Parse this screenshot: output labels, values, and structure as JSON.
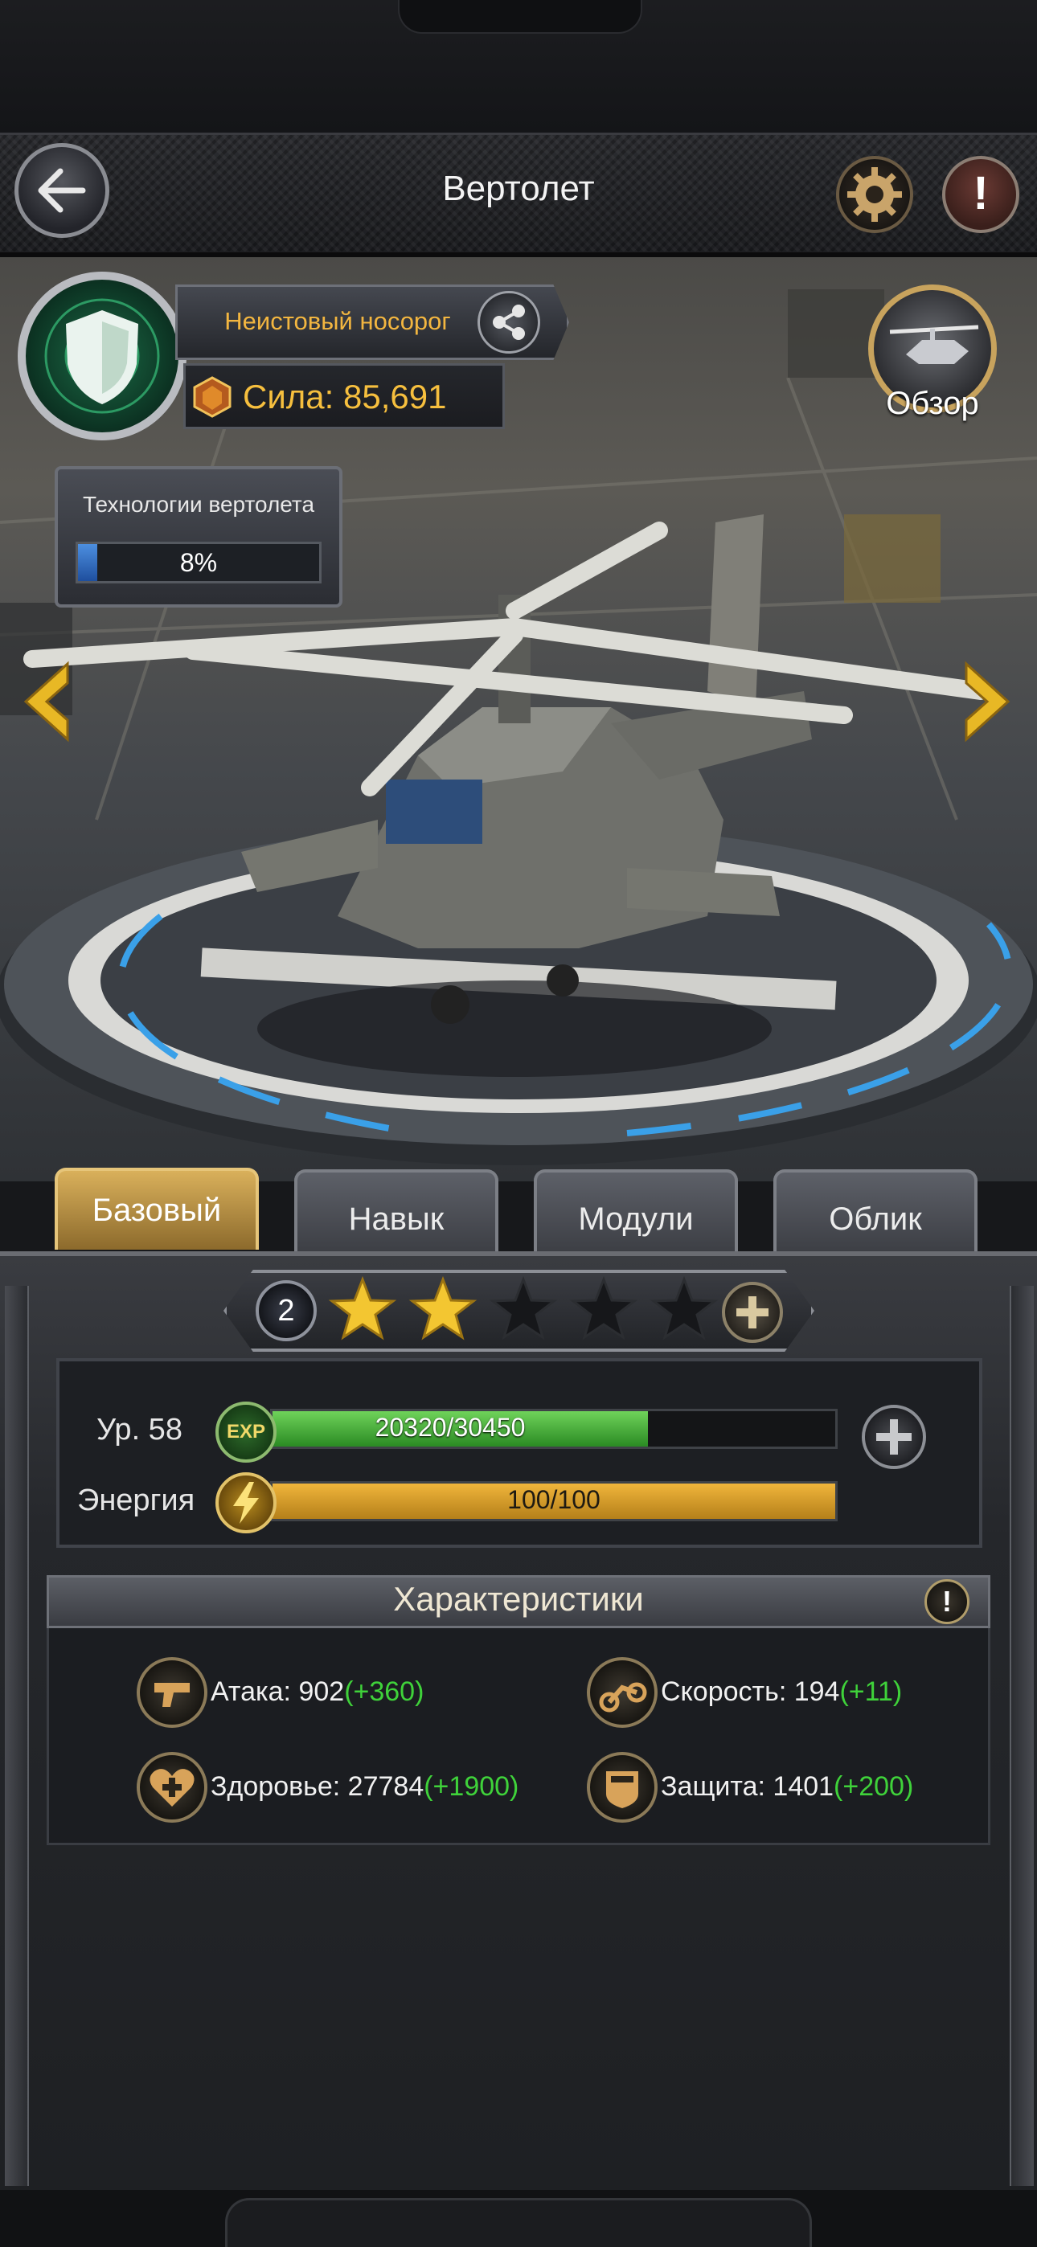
{
  "header": {
    "title": "Вертолет"
  },
  "commander": {
    "name": "Неистовый носорог",
    "power_label": "Сила: 85,691"
  },
  "overview": {
    "label": "Обзор"
  },
  "tech": {
    "label": "Технологии вертолета",
    "progress_text": "8%",
    "progress_fraction": 0.08
  },
  "tabs": [
    {
      "label": "Базовый",
      "active": true
    },
    {
      "label": "Навык",
      "active": false
    },
    {
      "label": "Модули",
      "active": false
    },
    {
      "label": "Облик",
      "active": false
    }
  ],
  "stars": {
    "rank": "2",
    "filled": 2,
    "total": 5
  },
  "level": {
    "label": "Ур. 58",
    "exp_icon_text": "EXP",
    "exp_text": "20320/30450",
    "exp_fraction": 0.667
  },
  "energy": {
    "label": "Энергия",
    "value_text": "100/100",
    "fraction": 1.0
  },
  "stats": {
    "title": "Характеристики",
    "attack": {
      "label": "Атака: 902",
      "bonus": "(+360)"
    },
    "speed": {
      "label": "Скорость: 194",
      "bonus": "(+11)"
    },
    "health": {
      "label": "Здоровье: 27784",
      "bonus": "(+1900)"
    },
    "defense": {
      "label": "Защита: 1401",
      "bonus": "(+200)"
    }
  },
  "colors": {
    "gold": "#f6bf3e",
    "bonus_green": "#3fd23a",
    "exp_green": "#4bb53c",
    "energy_gold": "#e2a932",
    "tech_blue": "#3c7ed4"
  }
}
